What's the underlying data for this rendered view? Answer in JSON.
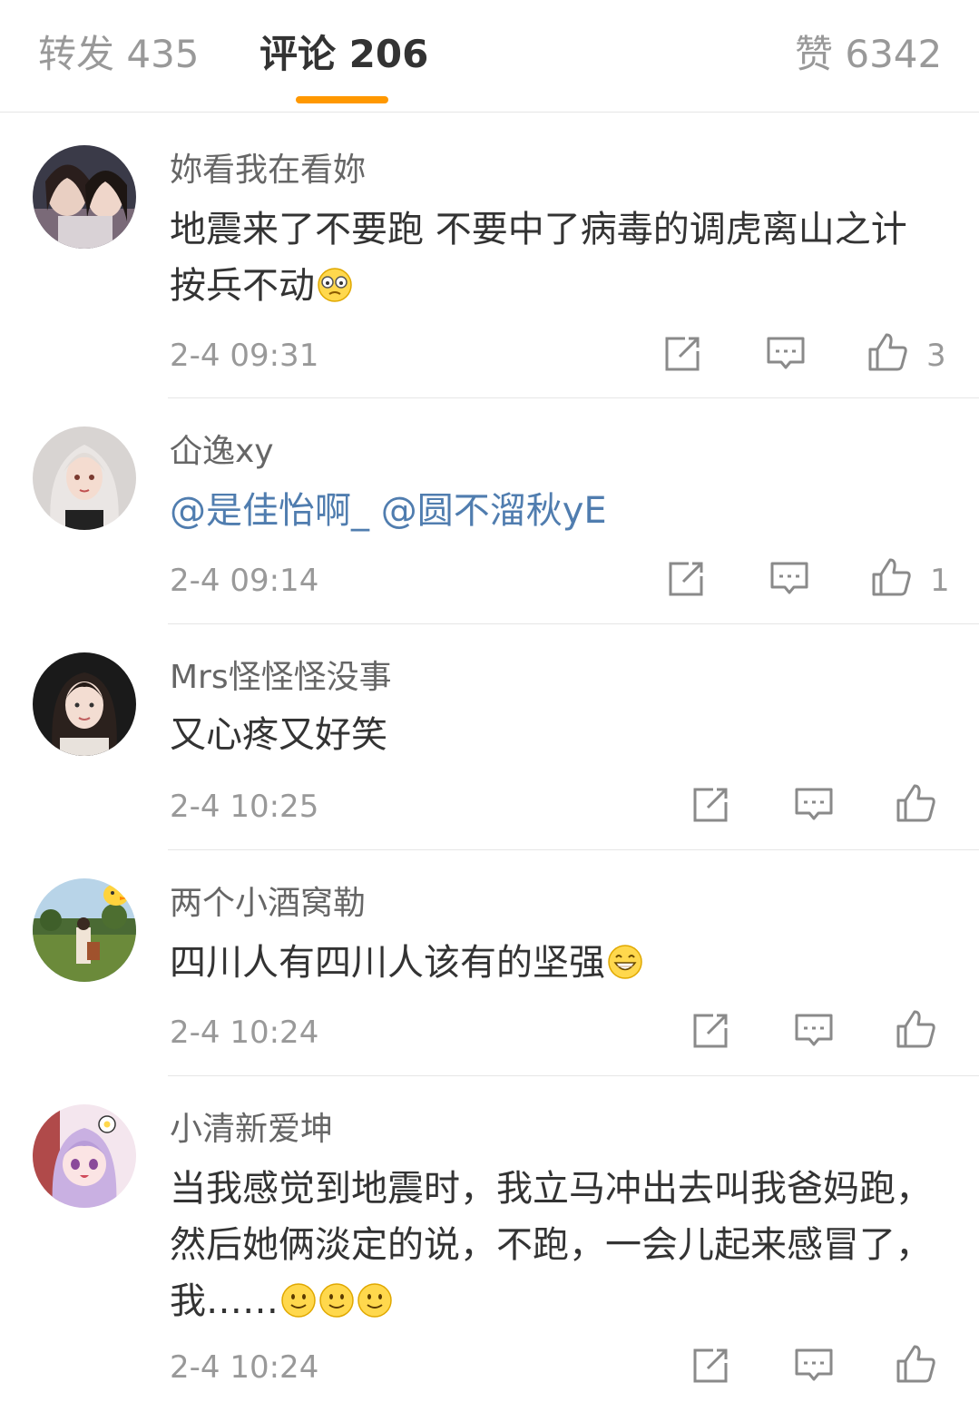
{
  "tabs": {
    "repost": "转发 435",
    "comments": "评论 206",
    "likes": "赞 6342"
  },
  "comments": [
    {
      "username": "妳看我在看妳",
      "content": "地震来了不要跑 不要中了病毒的调虎离山之计  按兵不动",
      "emoji": "thinking-emoji",
      "time": "2-4 09:31",
      "likes": "3"
    },
    {
      "username": "仚逸xy",
      "mentions": [
        "@是佳怡啊_",
        "@圆不溜秋yE"
      ],
      "time": "2-4 09:14",
      "likes": "1"
    },
    {
      "username": "Mrs怪怪怪没事",
      "content": "又心疼又好笑",
      "time": "2-4 10:25",
      "likes": ""
    },
    {
      "username": "两个小酒窝勒",
      "content": "四川人有四川人该有的坚强",
      "emoji": "grin-emoji",
      "time": "2-4 10:24",
      "likes": ""
    },
    {
      "username": "小清新爱坤",
      "content": "当我感觉到地震时，我立马冲出去叫我爸妈跑，然后她俩淡定的说，不跑，一会儿起来感冒了，我……",
      "emoji": "smile-emoji",
      "time": "2-4 10:24",
      "likes": ""
    }
  ],
  "icons": {
    "repost": "repost-icon",
    "reply": "comment-icon",
    "like": "thumbs-up-icon"
  },
  "colors": {
    "accent": "#ff9800",
    "mention": "#507daf",
    "secondary_text": "#999999"
  }
}
